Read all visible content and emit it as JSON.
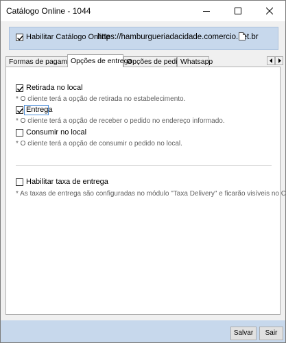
{
  "window": {
    "title": "Catálogo Online - 1044"
  },
  "header": {
    "enable_catalog_label": "Habilitar Catálogo Online",
    "enable_catalog_checked": true,
    "catalog_url": "https://hamburgueriadacidade.comercio.net.br"
  },
  "tabs": [
    {
      "label": "Formas de pagamento",
      "active": false
    },
    {
      "label": "Opções de entrega",
      "active": true
    },
    {
      "label": "Opções de pedido",
      "active": false
    },
    {
      "label": "Whatsapp",
      "active": false
    }
  ],
  "options": [
    {
      "label": "Retirada no local",
      "checked": true,
      "note": "* O cliente terá a opção de retirada no estabelecimento."
    },
    {
      "label": "Entrega",
      "checked": true,
      "note": "* O cliente terá a opção de receber o pedido no endereço informado."
    },
    {
      "label": "Consumir no local",
      "checked": false,
      "note": "* O cliente terá a opção de consumir o pedido no local."
    }
  ],
  "delivery_fee": {
    "label": "Habilitar taxa de entrega",
    "checked": false,
    "note": "* As taxas de entrega são configuradas no módulo \"Taxa Delivery\" e ficarão visíveis no Catálogo"
  },
  "footer": {
    "save_label": "Salvar",
    "exit_label": "Sair"
  }
}
